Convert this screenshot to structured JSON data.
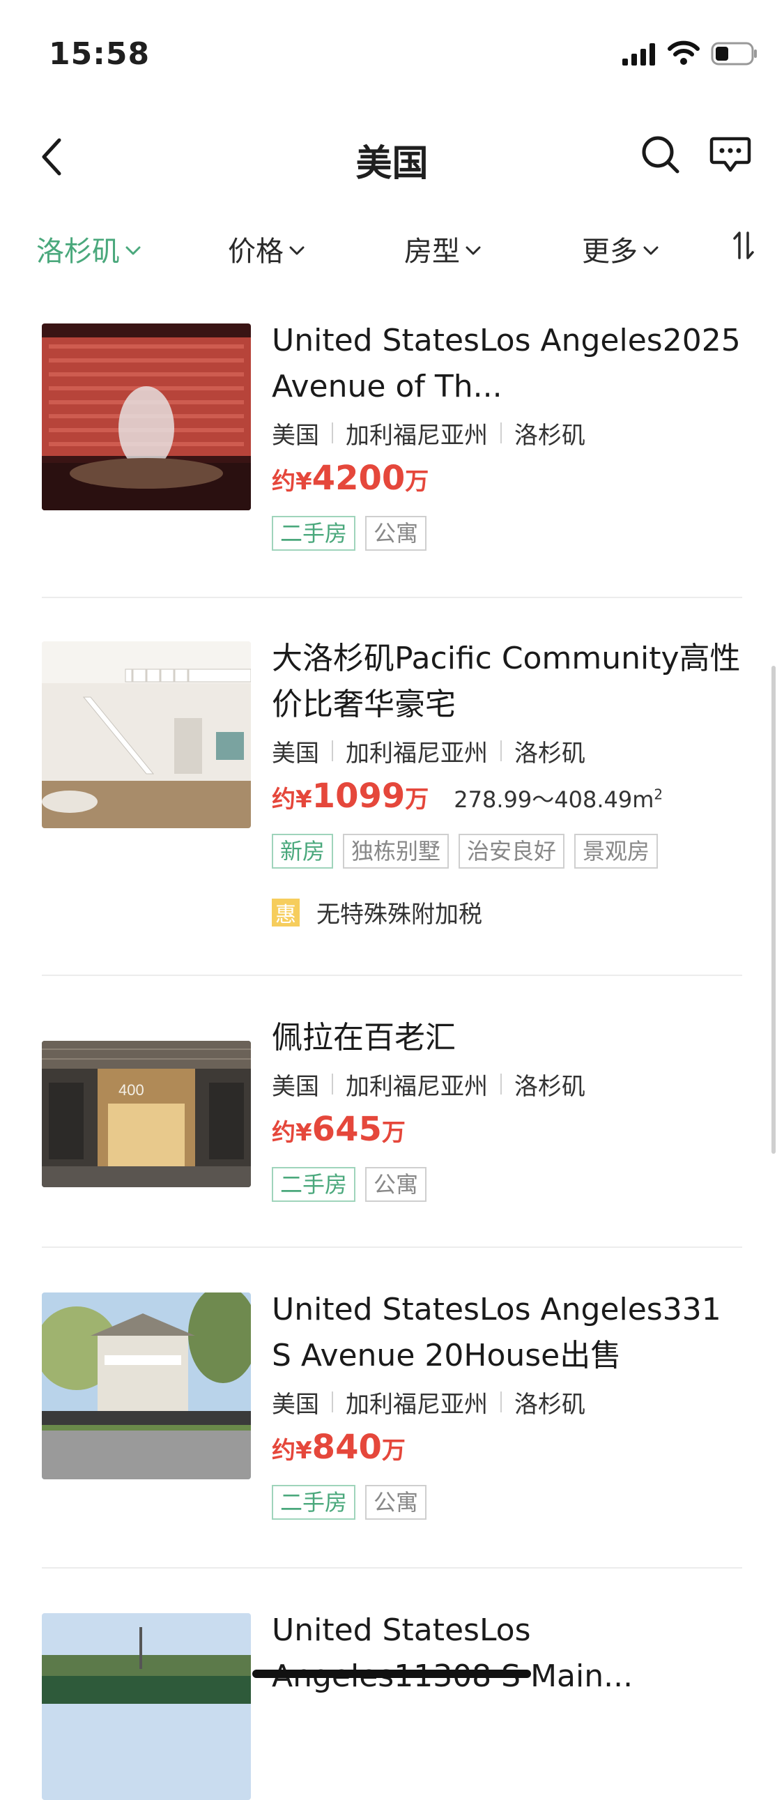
{
  "status_bar": {
    "time": "15:58"
  },
  "nav": {
    "title": "美国"
  },
  "filters": [
    {
      "label": "洛杉矶",
      "active": true
    },
    {
      "label": "价格",
      "active": false
    },
    {
      "label": "房型",
      "active": false
    },
    {
      "label": "更多",
      "active": false
    }
  ],
  "listings": [
    {
      "title": "United StatesLos Angeles2025 Avenue of Th...",
      "country": "美国",
      "state": "加利福尼亚州",
      "city": "洛杉矶",
      "price_prefix": "约¥",
      "price_value": "4200",
      "price_unit": "万",
      "tags": [
        "二手房",
        "公寓"
      ]
    },
    {
      "title": "大洛杉矶Pacific Community高性价比奢华豪宅",
      "country": "美国",
      "state": "加利福尼亚州",
      "city": "洛杉矶",
      "price_prefix": "约¥",
      "price_value": "1099",
      "price_unit": "万",
      "area": "278.99～408.49m",
      "area_sup": "2",
      "tags": [
        "新房",
        "独栋别墅",
        "治安良好",
        "景观房"
      ],
      "perk_badge": "惠",
      "perk_text": "无特殊殊附加税"
    },
    {
      "title": "佩拉在百老汇",
      "country": "美国",
      "state": "加利福尼亚州",
      "city": "洛杉矶",
      "price_prefix": "约¥",
      "price_value": "645",
      "price_unit": "万",
      "tags": [
        "二手房",
        "公寓"
      ],
      "image_text": "400"
    },
    {
      "title": "United StatesLos Angeles331 S Avenue 20House出售",
      "country": "美国",
      "state": "加利福尼亚州",
      "city": "洛杉矶",
      "price_prefix": "约¥",
      "price_value": "840",
      "price_unit": "万",
      "tags": [
        "二手房",
        "公寓"
      ]
    },
    {
      "title": "United StatesLos Angeles11308 S Main..."
    }
  ],
  "colors": {
    "accent": "#4aa87c",
    "price": "#e5473b"
  }
}
